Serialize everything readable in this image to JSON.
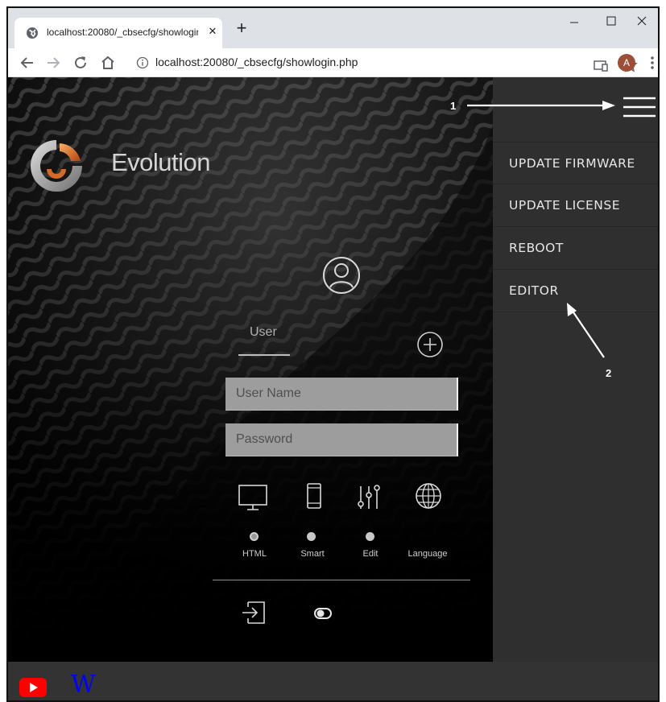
{
  "browser": {
    "tab_title": "localhost:20080/_cbsecfg/showlogin.php",
    "tab_close_glyph": "✕",
    "new_tab_glyph": "+",
    "url": "localhost:20080/_cbsecfg/showlogin.php",
    "profile_initial": "A",
    "profile_color": "#9c4f36",
    "icons": [
      "globe-favicon",
      "minimize-icon",
      "maximize-icon",
      "close-icon",
      "back-arrow-icon",
      "forward-arrow-icon",
      "reload-icon",
      "home-icon",
      "info-icon",
      "cast-icon",
      "star-icon",
      "kebab-menu-icon"
    ]
  },
  "login": {
    "brand": "Evolution",
    "user_tab": "User",
    "username_placeholder": "User Name",
    "password_placeholder": "Password",
    "modes": [
      {
        "label": "HTML",
        "icon": "monitor-icon",
        "selected": true
      },
      {
        "label": "Smart",
        "icon": "phone-icon",
        "selected": false
      },
      {
        "label": "Edit",
        "icon": "sliders-icon",
        "selected": false
      },
      {
        "label": "Language",
        "icon": "globe-icon",
        "selected": false
      }
    ],
    "icons": [
      "evolution-logo-icon",
      "user-avatar-icon",
      "add-user-icon",
      "login-icon",
      "toggle-icon"
    ]
  },
  "side_menu": {
    "items": [
      "UPDATE FIRMWARE",
      "UPDATE LICENSE",
      "REBOOT",
      "EDITOR"
    ],
    "icons": [
      "hamburger-menu-icon"
    ]
  },
  "footer": {
    "wikipedia_glyph": "W",
    "icons": [
      "youtube-icon",
      "wikipedia-icon"
    ],
    "colors": {
      "youtube": "#ff0000",
      "wikipedia": "#0000ff"
    }
  },
  "annotations": {
    "label_1": "1",
    "label_2": "2"
  }
}
